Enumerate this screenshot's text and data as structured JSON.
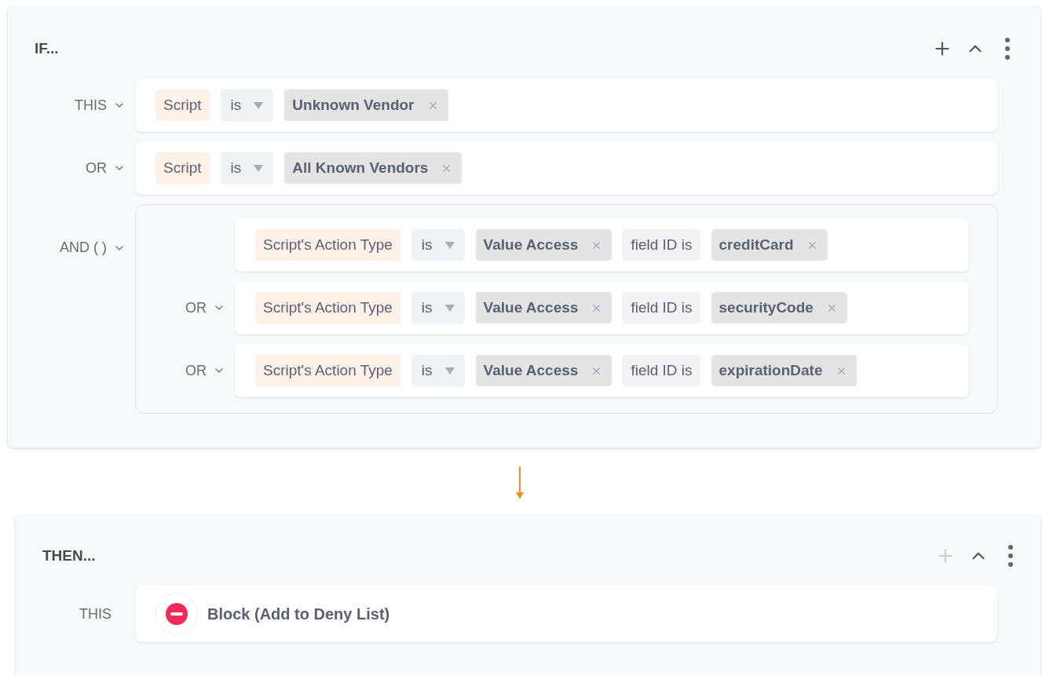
{
  "if_block": {
    "title": "IF...",
    "add_disabled": false,
    "conditions": [
      {
        "kind": "rule",
        "connector": "THIS",
        "tokens": [
          {
            "kind": "attribute",
            "text": "Script"
          },
          {
            "kind": "operator",
            "text": "is"
          },
          {
            "kind": "value",
            "text": "Unknown Vendor"
          }
        ]
      },
      {
        "kind": "rule",
        "connector": "OR",
        "tokens": [
          {
            "kind": "attribute",
            "text": "Script"
          },
          {
            "kind": "operator",
            "text": "is"
          },
          {
            "kind": "value",
            "text": "All Known Vendors"
          }
        ]
      },
      {
        "kind": "group",
        "connector": "AND ( )",
        "children": [
          {
            "kind": "rule",
            "tokens": [
              {
                "kind": "attribute",
                "text": "Script's Action Type"
              },
              {
                "kind": "operator",
                "text": "is"
              },
              {
                "kind": "value",
                "text": "Value Access"
              },
              {
                "kind": "label",
                "text": "field ID is"
              },
              {
                "kind": "value",
                "text": "creditCard"
              }
            ]
          },
          {
            "kind": "rule",
            "connector": "OR",
            "tokens": [
              {
                "kind": "attribute",
                "text": "Script's Action Type"
              },
              {
                "kind": "operator",
                "text": "is"
              },
              {
                "kind": "value",
                "text": "Value Access"
              },
              {
                "kind": "label",
                "text": "field ID is"
              },
              {
                "kind": "value",
                "text": "securityCode"
              }
            ]
          },
          {
            "kind": "rule",
            "connector": "OR",
            "tokens": [
              {
                "kind": "attribute",
                "text": "Script's Action Type"
              },
              {
                "kind": "operator",
                "text": "is"
              },
              {
                "kind": "value",
                "text": "Value Access"
              },
              {
                "kind": "label",
                "text": "field ID is"
              },
              {
                "kind": "value",
                "text": "expirationDate"
              }
            ]
          }
        ]
      }
    ]
  },
  "then_block": {
    "title": "THEN...",
    "add_disabled": true,
    "actions": [
      {
        "connector": "THIS",
        "label": "Block (Add to Deny List)"
      }
    ]
  }
}
